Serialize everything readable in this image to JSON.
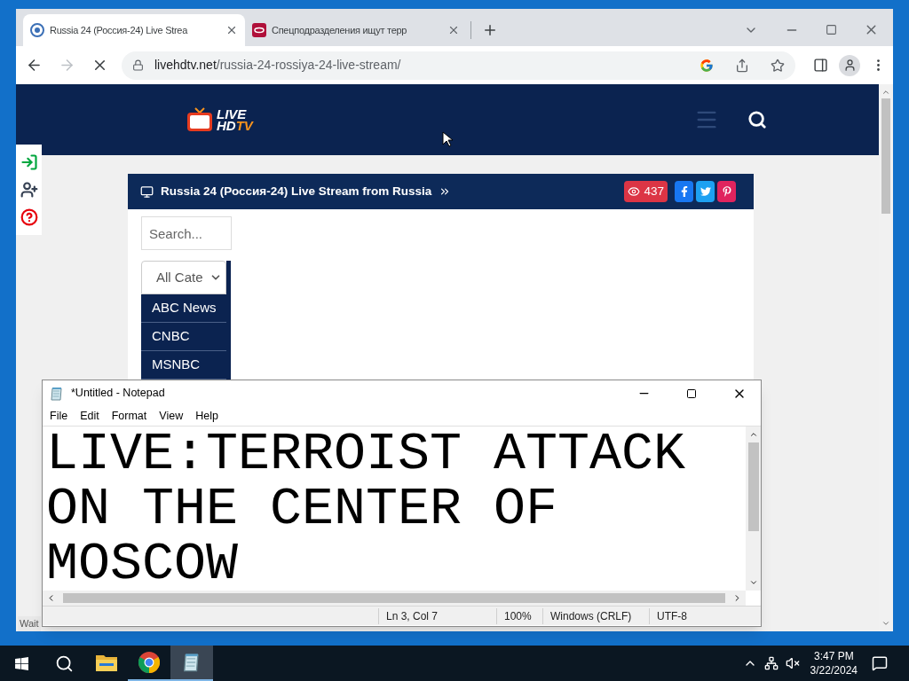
{
  "browser": {
    "tabs": [
      {
        "kind": "site",
        "title": "Russia 24 (Россия-24) Live Strea",
        "selected": true
      },
      {
        "kind": "news",
        "title": "Спецподразделения ищут терр",
        "selected": false
      }
    ],
    "nav": [
      {
        "kind": "back",
        "disabled": false
      },
      {
        "kind": "forward",
        "disabled": true
      },
      {
        "kind": "stop",
        "disabled": false
      }
    ],
    "address": {
      "host": "livehdtv.net",
      "path": "/russia-24-rossiya-24-live-stream/"
    },
    "status": "Wait"
  },
  "site": {
    "logo": {
      "top": "LIVE",
      "bottom": "HD",
      "accent": "TV"
    },
    "side_tools": [
      {
        "kind": "login"
      },
      {
        "kind": "register"
      },
      {
        "kind": "help"
      }
    ],
    "heading": "Russia 24 (Россия-24) Live Stream from Russia",
    "views": "437",
    "share": [
      {
        "kind": "facebook",
        "color": "#1877f2"
      },
      {
        "kind": "twitter",
        "color": "#1da1f2"
      },
      {
        "kind": "pinterest",
        "color": "#e0245e"
      }
    ],
    "search": {
      "placeholder": "Search..."
    },
    "category": "All Cate",
    "channels": [
      "ABC News",
      "CNBC",
      "MSNBC"
    ]
  },
  "notepad": {
    "title": "*Untitled - Notepad",
    "menu": [
      "File",
      "Edit",
      "Format",
      "View",
      "Help"
    ],
    "text": "LIVE:TERROIST ATTACK ON THE CENTER OF MOSCOW",
    "status": [
      "Ln 3, Col 7",
      "100%",
      "Windows (CRLF)",
      "UTF-8"
    ]
  },
  "taskbar": {
    "apps": [
      {
        "kind": "explorer",
        "running": false,
        "selected": false
      },
      {
        "kind": "chrome",
        "running": true,
        "selected": false
      },
      {
        "kind": "notepad",
        "running": true,
        "selected": true
      }
    ],
    "time": "3:47 PM",
    "date": "3/22/2024"
  }
}
